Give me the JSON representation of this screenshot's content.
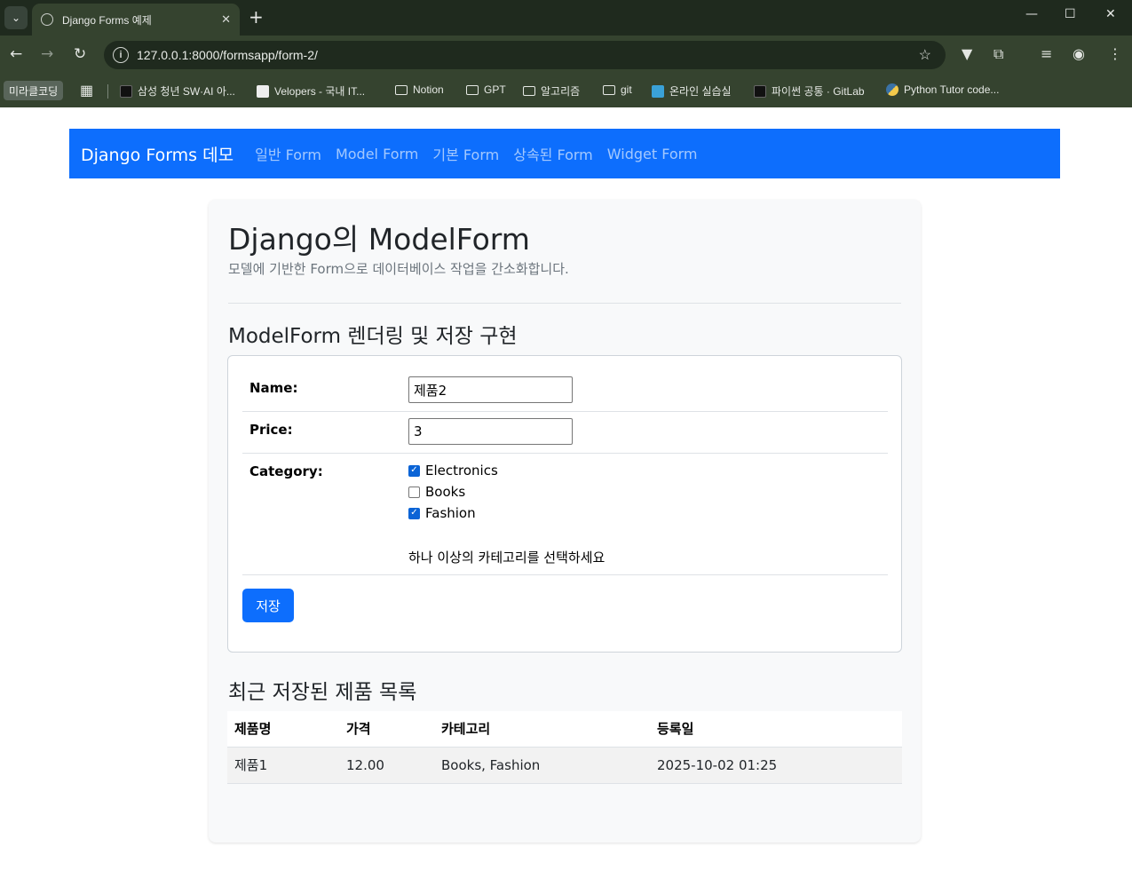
{
  "browser": {
    "tab_title": "Django Forms 예제",
    "tab_close": "✕",
    "new_tab": "+",
    "url": "127.0.0.1:8000/formsapp/form-2/",
    "bookmarks": {
      "profile": "미라클코딩",
      "items": [
        "삼성 청년 SW·AI 아...",
        "Velopers - 국내 IT...",
        "Notion",
        "GPT",
        "알고리즘",
        "git",
        "온라인 실습실",
        "파이썬 공통 · GitLab",
        "Python Tutor code..."
      ]
    }
  },
  "navbar": {
    "brand": "Django Forms 데모",
    "links": [
      "일반 Form",
      "Model Form",
      "기본 Form",
      "상속된 Form",
      "Widget Form"
    ]
  },
  "page": {
    "title": "Django의 ModelForm",
    "lead": "모델에 기반한 Form으로 데이터베이스 작업을 간소화합니다.",
    "section_title": "ModelForm 렌더링 및 저장 구현"
  },
  "form": {
    "name_label": "Name:",
    "name_value": "제품2",
    "price_label": "Price:",
    "price_value": "3",
    "category_label": "Category:",
    "categories": [
      {
        "label": "Electronics",
        "checked": true
      },
      {
        "label": "Books",
        "checked": false
      },
      {
        "label": "Fashion",
        "checked": true
      }
    ],
    "category_help": "하나 이상의 카테고리를 선택하세요",
    "save_label": "저장"
  },
  "recent": {
    "title": "최근 저장된 제품 목록",
    "headers": [
      "제품명",
      "가격",
      "카테고리",
      "등록일"
    ],
    "rows": [
      [
        "제품1",
        "12.00",
        "Books, Fashion",
        "2025-10-02 01:25"
      ]
    ]
  },
  "colors": {
    "primary": "#0d6efd",
    "chrome_dark": "#1f2a1e",
    "chrome": "#35432f"
  }
}
